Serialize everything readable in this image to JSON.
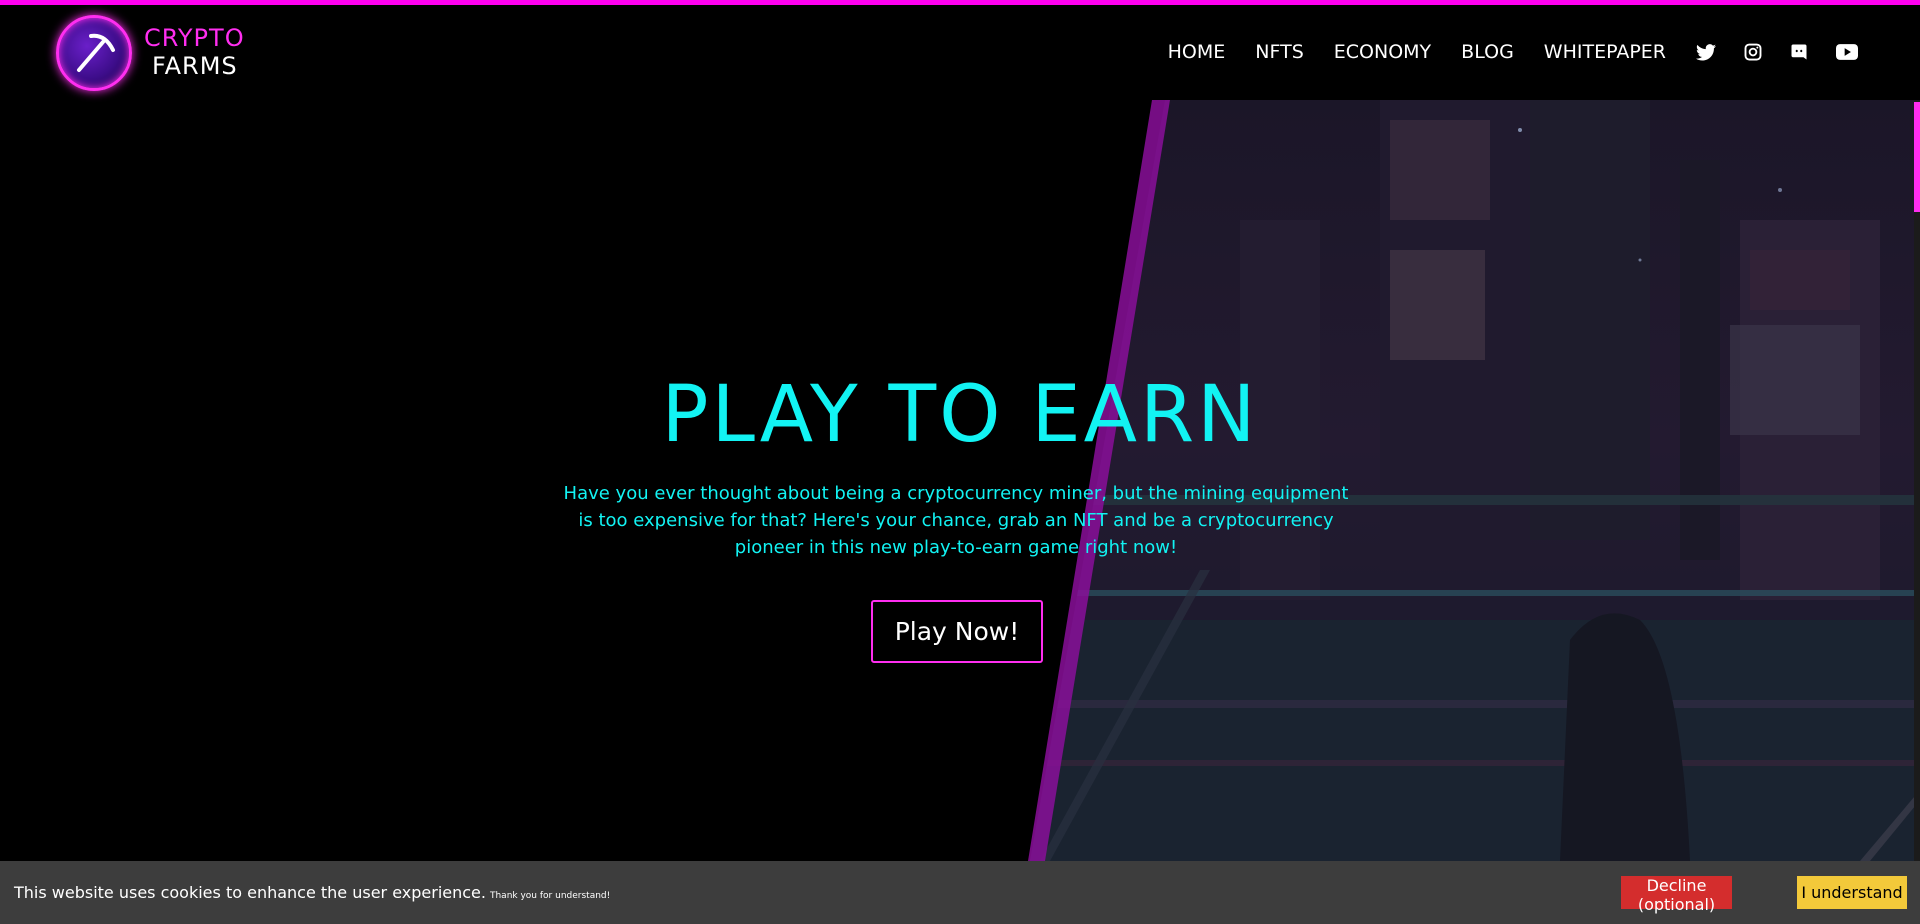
{
  "brand": {
    "line1": "CRYPTO",
    "line2": "FARMS",
    "accent_color": "#ff2ef0",
    "logo_icon": "pickaxe-icon"
  },
  "nav": {
    "items": [
      {
        "label": "HOME"
      },
      {
        "label": "NFTS"
      },
      {
        "label": "ECONOMY"
      },
      {
        "label": "BLOG"
      },
      {
        "label": "WHITEPAPER"
      }
    ],
    "social": [
      "twitter-icon",
      "instagram-icon",
      "discord-icon",
      "youtube-icon"
    ]
  },
  "hero": {
    "title": "PLAY TO EARN",
    "description": "Have you ever thought about being a cryptocurrency miner, but the mining equipment is too expensive for that? Here's your chance, grab an NFT and be a cryptocurrency pioneer in this new play-to-earn game right now!",
    "cta_label": "Play Now!",
    "title_color": "#12f3f3"
  },
  "cookie": {
    "message": "This website uses cookies to enhance the user experience.",
    "small_note": "Thank you for understand!",
    "decline_label": "Decline (optional)",
    "accept_label": "I understand",
    "decline_color": "#d42d2d",
    "accept_color": "#f3c93a"
  }
}
